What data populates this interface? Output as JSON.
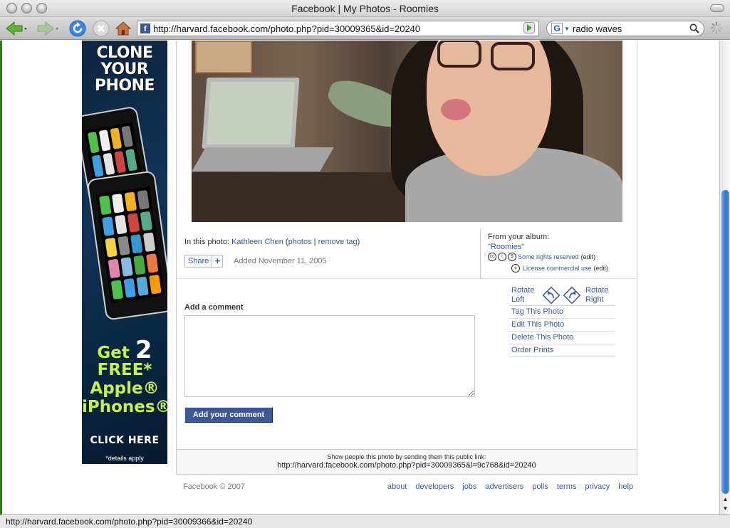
{
  "window": {
    "title": "Facebook | My Photos - Roomies"
  },
  "toolbar": {
    "url": "http://harvard.facebook.com/photo.php?pid=30009365&id=20240",
    "search_value": "radio waves"
  },
  "ad": {
    "headline": [
      "CLONE",
      "YOUR",
      "PHONE"
    ],
    "offer_get": "Get",
    "offer_number": "2",
    "offer_lines": [
      "FREE*",
      "Apple®",
      "iPhones®"
    ],
    "cta": "CLICK HERE",
    "fineprint": "*details apply"
  },
  "photo": {
    "in_this_photo_label": "In this photo:",
    "tagged_person": "Kathleen Chen",
    "photos_link": "photos",
    "remove_tag_link": "remove tag",
    "share_label": "Share",
    "share_plus": "+",
    "added_date": "Added November 11, 2005"
  },
  "album": {
    "from_label": "From your album:",
    "name": "\"Roomies\"",
    "rights_text": "Some rights reserved",
    "rights_edit": "(edit)",
    "license_text": "License commercial use",
    "license_edit": "(edit)"
  },
  "actions": {
    "rotate_left": [
      "Rotate",
      "Left"
    ],
    "rotate_right": [
      "Rotate",
      "Right"
    ],
    "items": [
      "Tag This Photo",
      "Edit This Photo",
      "Delete This Photo",
      "Order Prints"
    ]
  },
  "comment": {
    "label": "Add a comment",
    "value": "",
    "button": "Add your comment"
  },
  "public_link": {
    "caption": "Show people this photo by sending them this public link:",
    "url": "http://harvard.facebook.com/photo.php?pid=30009365&l=9c768&id=20240"
  },
  "footer": {
    "copyright": "Facebook © 2007",
    "links": [
      "about",
      "developers",
      "jobs",
      "advertisers",
      "polls",
      "terms",
      "privacy",
      "help"
    ]
  },
  "status": {
    "text": "http://harvard.facebook.com/photo.php?pid=30009366&id=20240"
  },
  "colors": {
    "brand": "#3b5998",
    "ad_green": "#c8f04a"
  },
  "icons": [
    "back-arrow-icon",
    "forward-arrow-icon",
    "reload-icon",
    "stop-icon",
    "home-icon",
    "go-icon",
    "google-icon",
    "magnifier-icon",
    "spinner-icon",
    "rotate-left-icon",
    "rotate-right-icon",
    "cc-icon",
    "license-icon"
  ]
}
